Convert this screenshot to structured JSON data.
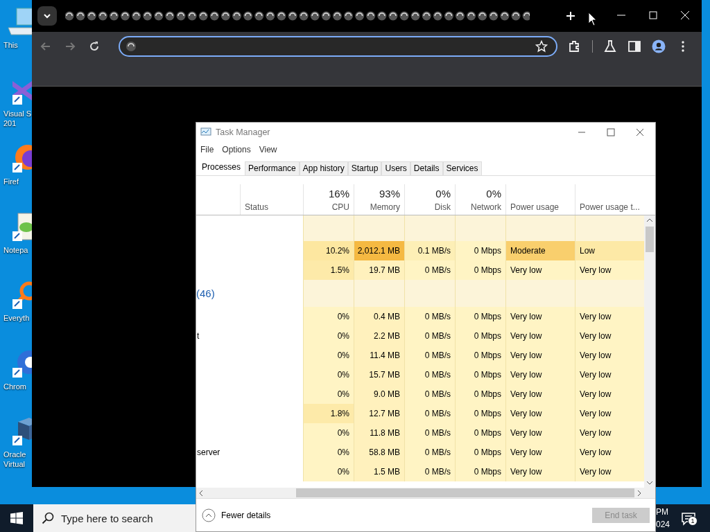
{
  "desktop": {
    "icons": [
      {
        "kind": "computer",
        "lines": [
          "This"
        ]
      },
      {
        "kind": "ide",
        "lines": [
          "Visual S",
          "201"
        ]
      },
      {
        "kind": "fox",
        "lines": [
          "Firef"
        ]
      },
      {
        "kind": "notepad",
        "lines": [
          "Notepa"
        ]
      },
      {
        "kind": "magnifier",
        "lines": [
          "Everyth"
        ]
      },
      {
        "kind": "ring",
        "lines": [
          "Chrom"
        ]
      },
      {
        "kind": "cube",
        "lines": [
          "Oracle",
          "Virtual"
        ]
      }
    ]
  },
  "task_manager": {
    "title": "Task Manager",
    "menu": [
      "File",
      "Options",
      "View"
    ],
    "tabs": [
      {
        "label": "Processes",
        "selected": true
      },
      {
        "label": "Performance",
        "selected": false
      },
      {
        "label": "App history",
        "selected": false
      },
      {
        "label": "Startup",
        "selected": false
      },
      {
        "label": "Users",
        "selected": false
      },
      {
        "label": "Details",
        "selected": false
      },
      {
        "label": "Services",
        "selected": false
      }
    ],
    "status_header": "Status",
    "columns": [
      {
        "kind": "metric",
        "summary": "16%",
        "label": "CPU"
      },
      {
        "kind": "metric",
        "summary": "93%",
        "label": "Memory"
      },
      {
        "kind": "metric",
        "summary": "0%",
        "label": "Disk"
      },
      {
        "kind": "metric",
        "summary": "0%",
        "label": "Network"
      },
      {
        "kind": "text",
        "label": "Power usage"
      },
      {
        "kind": "text",
        "label": "Power usage t..."
      }
    ],
    "rows": [
      {
        "kind": "group",
        "cells": [
          {
            "color": "#fcf4d9"
          },
          {
            "color": "#fcf4d9"
          },
          {
            "color": "#fcf4d9"
          },
          {
            "color": "#fcf4d9"
          },
          {
            "color": "#fcf4d9"
          },
          {
            "color": "#fcf4d9"
          }
        ]
      },
      {
        "kind": "process",
        "cells": [
          {
            "text": "10.2%",
            "color": "#fde7a0"
          },
          {
            "text": "2,012.1 MB",
            "color": "#f5b942"
          },
          {
            "text": "0.1 MB/s",
            "color": "#fdefb6"
          },
          {
            "text": "0 Mbps",
            "color": "#fff4c4"
          },
          {
            "text": "Moderate",
            "color": "#f9cf6d"
          },
          {
            "text": "Low",
            "color": "#fde9a6"
          }
        ]
      },
      {
        "kind": "process",
        "cells": [
          {
            "text": "1.5%",
            "color": "#fdeaa9"
          },
          {
            "text": "19.7 MB",
            "color": "#fff1bd"
          },
          {
            "text": "0 MB/s",
            "color": "#fff4c4"
          },
          {
            "text": "0 Mbps",
            "color": "#fff4c4"
          },
          {
            "text": "Very low",
            "color": "#fff4c4"
          },
          {
            "text": "Very low",
            "color": "#fff4c4"
          }
        ]
      },
      {
        "kind": "group",
        "name": "(46)",
        "cells": [
          {
            "color": "#fcf4d9"
          },
          {
            "color": "#fcf4d9"
          },
          {
            "color": "#fcf4d9"
          },
          {
            "color": "#fcf4d9"
          },
          {
            "color": "#fcf4d9"
          },
          {
            "color": "#fcf4d9"
          }
        ]
      },
      {
        "kind": "process",
        "cells": [
          {
            "text": "0%",
            "color": "#fff4c4"
          },
          {
            "text": "0.4 MB",
            "color": "#fff1bd"
          },
          {
            "text": "0 MB/s",
            "color": "#fff4c4"
          },
          {
            "text": "0 Mbps",
            "color": "#fff4c4"
          },
          {
            "text": "Very low",
            "color": "#fff4c4"
          },
          {
            "text": "Very low",
            "color": "#fff4c4"
          }
        ]
      },
      {
        "kind": "process",
        "name": "t",
        "cells": [
          {
            "text": "0%",
            "color": "#fff4c4"
          },
          {
            "text": "2.2 MB",
            "color": "#fff1bd"
          },
          {
            "text": "0 MB/s",
            "color": "#fff4c4"
          },
          {
            "text": "0 Mbps",
            "color": "#fff4c4"
          },
          {
            "text": "Very low",
            "color": "#fff4c4"
          },
          {
            "text": "Very low",
            "color": "#fff4c4"
          }
        ]
      },
      {
        "kind": "process",
        "cells": [
          {
            "text": "0%",
            "color": "#fff4c4"
          },
          {
            "text": "11.4 MB",
            "color": "#fff1bd"
          },
          {
            "text": "0 MB/s",
            "color": "#fff4c4"
          },
          {
            "text": "0 Mbps",
            "color": "#fff4c4"
          },
          {
            "text": "Very low",
            "color": "#fff4c4"
          },
          {
            "text": "Very low",
            "color": "#fff4c4"
          }
        ]
      },
      {
        "kind": "process",
        "cells": [
          {
            "text": "0%",
            "color": "#fff4c4"
          },
          {
            "text": "15.7 MB",
            "color": "#fff1bd"
          },
          {
            "text": "0 MB/s",
            "color": "#fff4c4"
          },
          {
            "text": "0 Mbps",
            "color": "#fff4c4"
          },
          {
            "text": "Very low",
            "color": "#fff4c4"
          },
          {
            "text": "Very low",
            "color": "#fff4c4"
          }
        ]
      },
      {
        "kind": "process",
        "cells": [
          {
            "text": "0%",
            "color": "#fff4c4"
          },
          {
            "text": "9.0 MB",
            "color": "#fff1bd"
          },
          {
            "text": "0 MB/s",
            "color": "#fff4c4"
          },
          {
            "text": "0 Mbps",
            "color": "#fff4c4"
          },
          {
            "text": "Very low",
            "color": "#fff4c4"
          },
          {
            "text": "Very low",
            "color": "#fff4c4"
          }
        ]
      },
      {
        "kind": "process",
        "cells": [
          {
            "text": "1.8%",
            "color": "#fdeaa9"
          },
          {
            "text": "12.7 MB",
            "color": "#fff1bd"
          },
          {
            "text": "0 MB/s",
            "color": "#fff4c4"
          },
          {
            "text": "0 Mbps",
            "color": "#fff4c4"
          },
          {
            "text": "Very low",
            "color": "#fff4c4"
          },
          {
            "text": "Very low",
            "color": "#fff4c4"
          }
        ]
      },
      {
        "kind": "process",
        "cells": [
          {
            "text": "0%",
            "color": "#fff4c4"
          },
          {
            "text": "11.8 MB",
            "color": "#fff1bd"
          },
          {
            "text": "0 MB/s",
            "color": "#fff4c4"
          },
          {
            "text": "0 Mbps",
            "color": "#fff4c4"
          },
          {
            "text": "Very low",
            "color": "#fff4c4"
          },
          {
            "text": "Very low",
            "color": "#fff4c4"
          }
        ]
      },
      {
        "kind": "process",
        "name": "server",
        "cells": [
          {
            "text": "0%",
            "color": "#fff4c4"
          },
          {
            "text": "58.8 MB",
            "color": "#fff1bd"
          },
          {
            "text": "0 MB/s",
            "color": "#fff4c4"
          },
          {
            "text": "0 Mbps",
            "color": "#fff4c4"
          },
          {
            "text": "Very low",
            "color": "#fff4c4"
          },
          {
            "text": "Very low",
            "color": "#fff4c4"
          }
        ]
      },
      {
        "kind": "process",
        "cells": [
          {
            "text": "0%",
            "color": "#fff4c4"
          },
          {
            "text": "1.5 MB",
            "color": "#fff1bd"
          },
          {
            "text": "0 MB/s",
            "color": "#fff4c4"
          },
          {
            "text": "0 Mbps",
            "color": "#fff4c4"
          },
          {
            "text": "Very low",
            "color": "#fff4c4"
          },
          {
            "text": "Very low",
            "color": "#fff4c4"
          }
        ]
      }
    ],
    "footer": {
      "toggle": "Fewer details",
      "end_task": {
        "label": "End task",
        "disabled": true
      }
    }
  },
  "taskbar": {
    "search": {
      "placeholder": "Type here to search"
    },
    "clock": [
      "PM",
      "024"
    ],
    "notifications": {
      "count": "1"
    }
  }
}
